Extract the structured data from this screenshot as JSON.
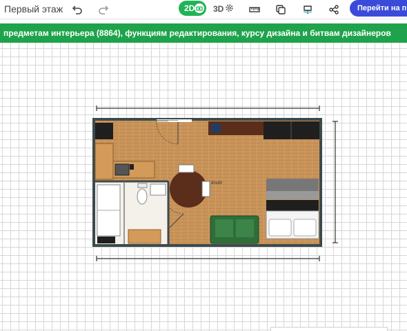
{
  "toolbar": {
    "floor_name": "Первый этаж",
    "mode_2d_label": "2D",
    "mode_3d_label": "3D",
    "goto_button": "Перейти на пр",
    "icons": [
      "undo-icon",
      "redo-icon",
      "camera-icon",
      "gear-icon",
      "ruler-icon",
      "copy-icon",
      "paint-icon",
      "share-icon"
    ]
  },
  "banner": {
    "text": "предметам интерьера (8864), функциям редактирования, курсу дизайна и битвам дизайнеров"
  },
  "plan": {
    "table_dimension": "80x80",
    "colors": {
      "floor": "#c9945a",
      "wall": "#3c4a4c",
      "sofa": "#2f6e3a",
      "dark_furniture": "#1f1f1f",
      "counter": "#d39a5a"
    }
  },
  "colors": {
    "accent_green": "#21b356",
    "banner_green": "#1ea34c",
    "button_blue": "#3a4bd9"
  }
}
